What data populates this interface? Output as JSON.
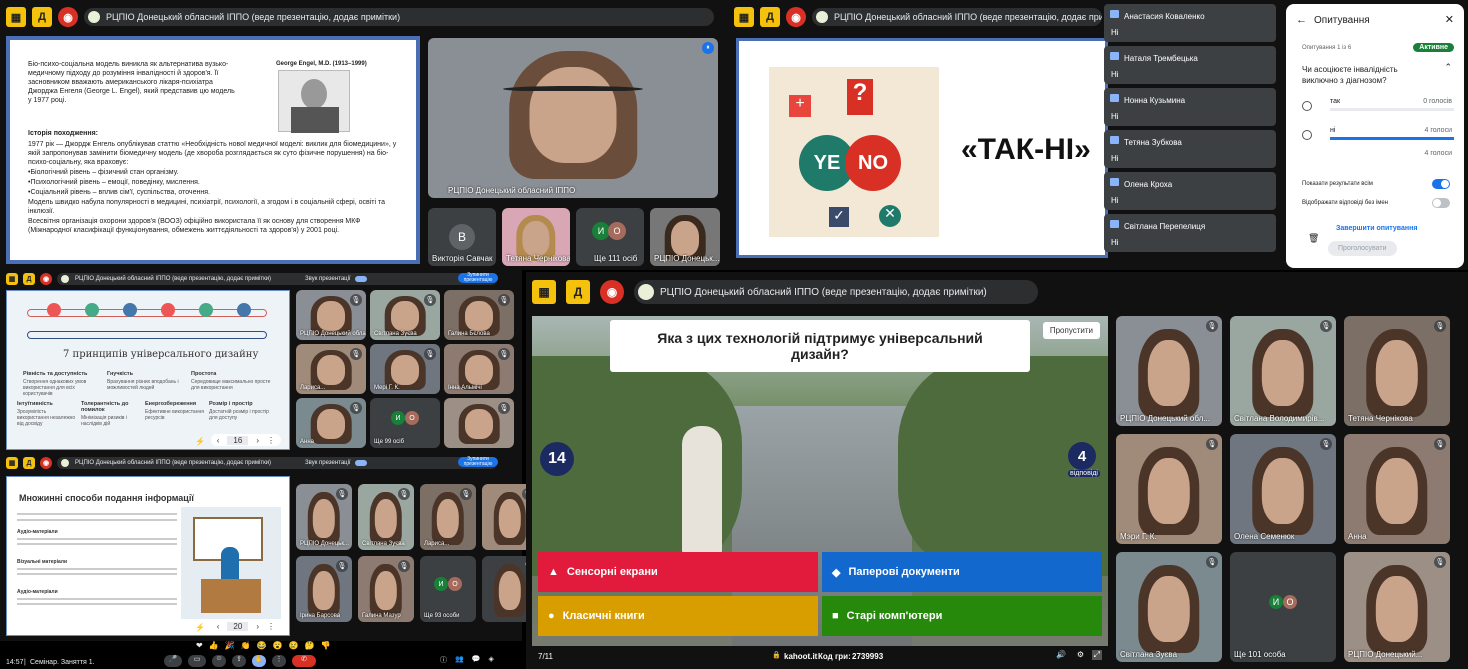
{
  "header": {
    "presenter_label": "РЦПІО Донецький обласний ІППО (веде презентацію, додає примітки)",
    "sound_label": "Звук презентації",
    "stop_label": "Зупинити презентацію"
  },
  "q1": {
    "slide_text": "Біо-психо-соціальна модель виникла як альтернатива вузько-медичному підходу до розуміння інвалідності й здоров'я. Її засновником вважають американського лікаря-психіатра Джорджа Енгеля (George L. Engel), який представив цю модель у 1977 році.",
    "photo_caption": "George Engel, M.D. (1913–1999)",
    "history_title": "Історія походження:",
    "history_lines": [
      "1977 рік — Джордж Енгель опублікував статтю «Необхідність нової медичної моделі: виклик для біомедицини», у якій запропонував замінити біомедичну модель (де хвороба розглядається як суто фізичне порушення) на біо-психо-соціальну, яка враховує:",
      "•Біологічний рівень – фізичний стан організму.",
      "•Психологічний рівень – емоції, поведінку, мислення.",
      "•Соціальний рівень – вплив сім'ї, суспільства, оточення.",
      "Модель швидко набула популярності в медицині, психіатрії, психології, а згодом і в соціальній сфері, освіті та інклюзії.",
      "Всесвітня організація охорони здоров'я (ВООЗ) офіційно використала її як основу для створення МКФ (Міжнародної класифікації функціонування, обмежень життєдіяльності та здоров'я) у 2001 році."
    ],
    "main_tile_name": "РЦПІО Донецький обласний ІППО",
    "tiles": [
      {
        "name": "Викторія Савчак",
        "initial": "В"
      },
      {
        "name": "Тетяна Чернікова"
      },
      {
        "name": "Ще 111 осіб",
        "initials": [
          "И",
          "О"
        ]
      },
      {
        "name": "РЦПІО Донецьк..."
      }
    ]
  },
  "q2": {
    "slide_title": "«ТАК-НІ»",
    "viewers": [
      {
        "name": "Анастасия Коваленко",
        "answer": "Ні"
      },
      {
        "name": "Наталя Трембецька",
        "answer": "Ні"
      },
      {
        "name": "Нонна Кузьмина",
        "answer": "Ні"
      },
      {
        "name": "Тетяна Зубкова",
        "answer": "Ні"
      },
      {
        "name": "Олена Кроха",
        "answer": "Ні"
      },
      {
        "name": "Світлана Перепелиця",
        "answer": "Ні"
      }
    ],
    "poll": {
      "title": "Опитування",
      "count": "Опитування 1 із 6",
      "status": "Активне",
      "question": "Чи асоціюєте інвалідність виключно з діагнозом?",
      "options": [
        {
          "label": "так",
          "votes": "0 голосів",
          "fill": 0
        },
        {
          "label": "ні",
          "votes": "4 голоси",
          "fill": 1
        }
      ],
      "total": "4 голоси",
      "show_results": "Показати результати всім",
      "anon": "Відображати відповіді без імен",
      "end": "Завершити опитування",
      "vote": "Проголосувати"
    }
  },
  "q3": {
    "slide_title": "7 принципів універсального дизайну",
    "principles": [
      {
        "title": "Рівність та доступність",
        "text": "Створення однакових умов використання для всіх користувачів"
      },
      {
        "title": "Гнучкість",
        "text": "Врахування різних вподобань і можливостей людей"
      },
      {
        "title": "Простота",
        "text": "Середовище максимально просте для використання"
      },
      {
        "title": "Інтуїтивність",
        "text": "Зрозумілість використання незалежно від досвіду"
      },
      {
        "title": "Толерантність до помилок",
        "text": "Мінімізація ризиків і наслідків дій"
      },
      {
        "title": "Енергозбереження",
        "text": "Ефективне використання ресурсів"
      },
      {
        "title": "Розмір і простір",
        "text": "Достатній розмір і простір для доступу"
      }
    ],
    "page": "16",
    "tiles": [
      {
        "name": "РЦПІО Донецький обласний..."
      },
      {
        "name": "Світлана Зуєва"
      },
      {
        "name": "Галина Бєлова"
      },
      {
        "name": "Лариса..."
      },
      {
        "name": "Мері Г. К."
      },
      {
        "name": "Інна Альмічі"
      },
      {
        "name": "Анна"
      },
      {
        "name": "Ще 99 осіб",
        "initials": [
          "И",
          "О"
        ]
      },
      {
        "name": ""
      }
    ]
  },
  "q4": {
    "slide_title": "Множинні способи подання інформації",
    "sections": [
      {
        "title": "Аудіо-матеріали"
      },
      {
        "title": "Візуальні матеріали"
      },
      {
        "title": "Аудіо-матеріали"
      }
    ],
    "page": "20",
    "tiles": [
      {
        "name": "РЦПІО Донецьк..."
      },
      {
        "name": "Світлана Зуєва"
      },
      {
        "name": "Лариса..."
      },
      {
        "name": ""
      },
      {
        "name": "Ірина Барсова"
      },
      {
        "name": "Галина Мазур"
      },
      {
        "name": "Ще 93 особи",
        "initials": [
          "И",
          "О"
        ]
      },
      {
        "name": ""
      }
    ]
  },
  "q5": {
    "question": "Яка з цих технологій підтримує універсальний дизайн?",
    "skip": "Пропустити",
    "timer": "14",
    "answers_count": "4",
    "answers_label": "відповіді",
    "answers": [
      {
        "label": "Сенсорні екрани",
        "color": "#e21b3c",
        "shape": "▲"
      },
      {
        "label": "Паперові документи",
        "color": "#1368ce",
        "shape": "◆"
      },
      {
        "label": "Класичні книги",
        "color": "#d89e00",
        "shape": "●"
      },
      {
        "label": "Старі комп'ютери",
        "color": "#26890c",
        "shape": "■"
      }
    ],
    "progress": "7/11",
    "site": "kahoot.it",
    "pin_label": "Код гри:",
    "pin": "2739993"
  },
  "gallery": [
    {
      "name": "РЦПІО Донецький обл..."
    },
    {
      "name": "Світлана Володимирів..."
    },
    {
      "name": "Тетяна Чернікова"
    },
    {
      "name": "Мэри Г. К."
    },
    {
      "name": "Олена Семенюк"
    },
    {
      "name": "Анна"
    },
    {
      "name": "Світлана Зуєва"
    },
    {
      "name": "Ще 101 особа",
      "initials": [
        "И",
        "О"
      ]
    },
    {
      "name": "РЦПІО Донецький..."
    }
  ],
  "bottom": {
    "time": "14:57",
    "meeting": "Семінар. Заняття 1."
  }
}
